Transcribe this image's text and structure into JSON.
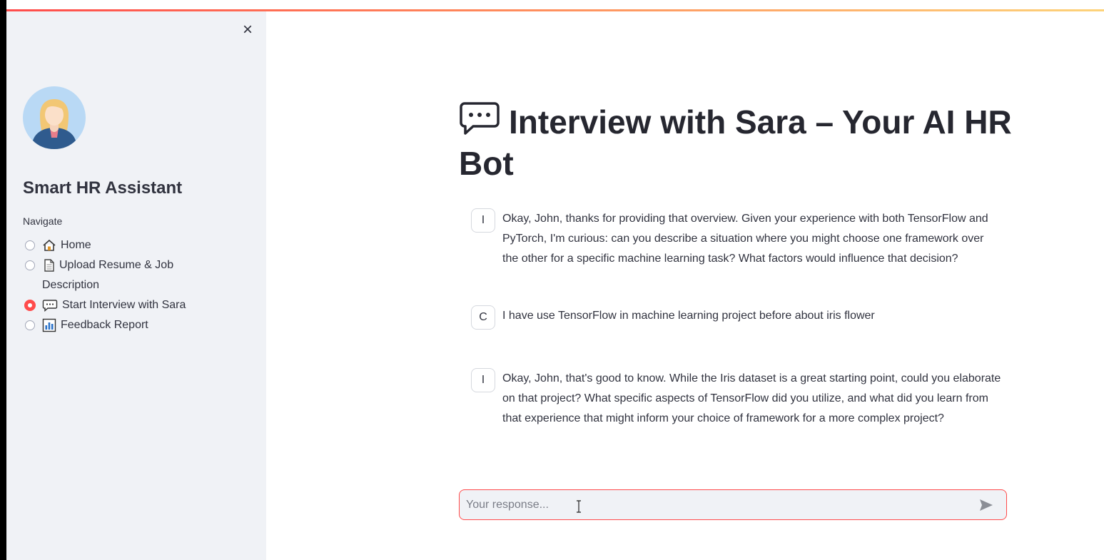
{
  "sidebar": {
    "close_icon": "close-icon",
    "avatar_icon": "hr-assistant-avatar",
    "app_title": "Smart HR Assistant",
    "nav_label": "Navigate",
    "nav_items": [
      {
        "label": "Home",
        "icon": "house-icon",
        "selected": false
      },
      {
        "label": "Upload Resume & Job",
        "label_line2": "Description",
        "icon": "document-icon",
        "selected": false
      },
      {
        "label": "Start Interview with Sara",
        "icon": "speech-bubble-icon",
        "selected": true
      },
      {
        "label": "Feedback Report",
        "icon": "bar-chart-icon",
        "selected": false
      }
    ]
  },
  "main": {
    "title": "Interview with Sara – Your AI HR Bot",
    "title_icon": "speech-bubble-icon",
    "messages": [
      {
        "role_initial": "I",
        "text": "Okay, John, thanks for providing that overview. Given your experience with both TensorFlow and PyTorch, I'm curious: can you describe a situation where you might choose one framework over the other for a specific machine learning task? What factors would influence that decision?"
      },
      {
        "role_initial": "C",
        "text": "I have use TensorFlow in machine learning project before about iris flower"
      },
      {
        "role_initial": "I",
        "text": "Okay, John, that's good to know. While the Iris dataset is a great starting point, could you elaborate on that project? What specific aspects of TensorFlow did you utilize, and what did you learn from that experience that might inform your choice of framework for a more complex project?"
      }
    ],
    "chat_input": {
      "placeholder": "Your response...",
      "value": "",
      "send_icon": "send-icon"
    }
  },
  "colors": {
    "accent": "#ff4b4b",
    "sidebar_bg": "#f0f2f6",
    "text": "#31333f"
  }
}
